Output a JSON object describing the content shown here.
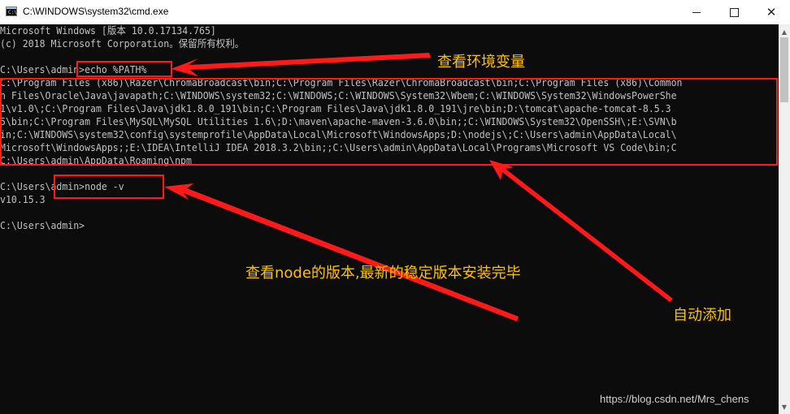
{
  "window": {
    "title": "C:\\WINDOWS\\system32\\cmd.exe",
    "icon_label": "C:\\",
    "minimize_glyph": "",
    "close_glyph": "✕"
  },
  "console": {
    "lines": [
      "Microsoft Windows [版本 10.0.17134.765]",
      "(c) 2018 Microsoft Corporation。保留所有权利。",
      "",
      "C:\\Users\\admin>echo %PATH%",
      "C:\\Program Files (x86)\\Razer\\ChromaBroadcast\\bin;C:\\Program Files\\Razer\\ChromaBroadcast\\bin;C:\\Program Files (x86)\\Common",
      "n Files\\Oracle\\Java\\javapath;C:\\WINDOWS\\system32;C:\\WINDOWS;C:\\WINDOWS\\System32\\Wbem;C:\\WINDOWS\\System32\\WindowsPowerShe",
      "1\\v1.0\\;C:\\Program Files\\Java\\jdk1.8.0_191\\bin;C:\\Program Files\\Java\\jdk1.8.0_191\\jre\\bin;D:\\tomcat\\apache-tomcat-8.5.3",
      "5\\bin;C:\\Program Files\\MySQL\\MySQL Utilities 1.6\\;D:\\maven\\apache-maven-3.6.0\\bin;;C:\\WINDOWS\\System32\\OpenSSH\\;E:\\SVN\\b",
      "in;C:\\WINDOWS\\system32\\config\\systemprofile\\AppData\\Local\\Microsoft\\WindowsApps;D:\\nodejs\\;C:\\Users\\admin\\AppData\\Local\\",
      "Microsoft\\WindowsApps;;E:\\IDEA\\IntelliJ IDEA 2018.3.2\\bin;;C:\\Users\\admin\\AppData\\Local\\Programs\\Microsoft VS Code\\bin;C",
      "C:\\Users\\admin\\AppData\\Roaming\\npm",
      "",
      "C:\\Users\\admin>node -v",
      "v10.15.3",
      "",
      "C:\\Users\\admin>"
    ]
  },
  "scrollbar": {
    "up_glyph": "▲",
    "down_glyph": "▼"
  },
  "annotations": {
    "view_env": "查看环境变量",
    "view_node": "查看node的版本,最新的稳定版本安装完毕",
    "auto_add": "自动添加",
    "highlight_color": "#ff1a1a",
    "text_color": "#ffc000"
  },
  "watermark": "https://blog.csdn.net/Mrs_chens"
}
